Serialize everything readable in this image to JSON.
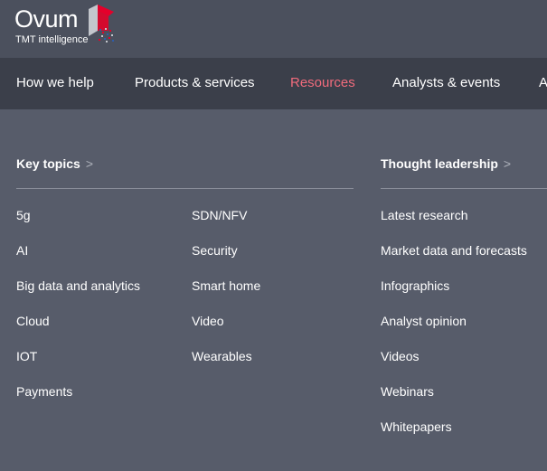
{
  "logo": {
    "wordmark": "Ovum",
    "tagline": "TMT intelligence",
    "mark_colors": [
      "#e4002b",
      "#c3c6cc",
      "#2f5dab"
    ]
  },
  "nav": {
    "items": [
      {
        "label": "How we help"
      },
      {
        "label": "Products & services"
      },
      {
        "label": "Resources",
        "active": true
      },
      {
        "label": "Analysts & events"
      },
      {
        "label": "A"
      }
    ],
    "active_color": "#f06b7c"
  },
  "key_topics": {
    "title": "Key topics",
    "chevron": ">",
    "column1": [
      "5g",
      "AI",
      "Big data and analytics",
      "Cloud",
      "IOT",
      "Payments"
    ],
    "column2": [
      "SDN/NFV",
      "Security",
      "Smart home",
      "Video",
      "Wearables"
    ]
  },
  "thought_leadership": {
    "title": "Thought leadership",
    "chevron": ">",
    "items": [
      "Latest research",
      "Market data and forecasts",
      "Infographics",
      "Analyst opinion",
      "Videos",
      "Webinars",
      "Whitepapers"
    ]
  }
}
